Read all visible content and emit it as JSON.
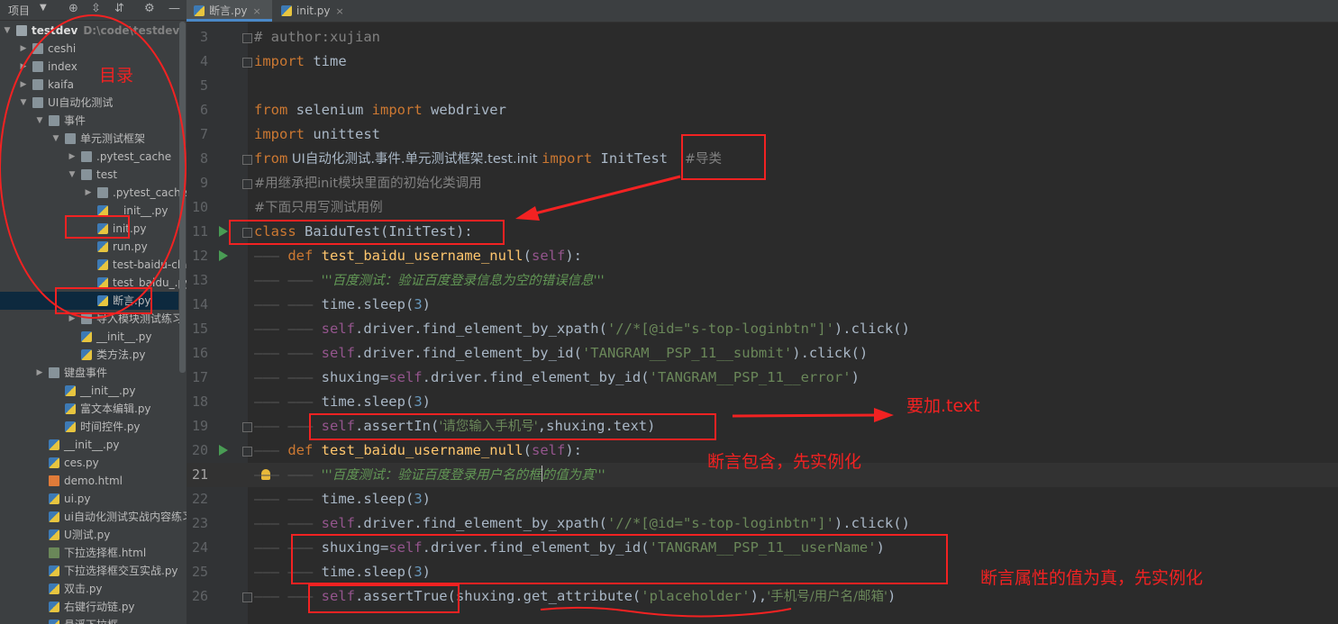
{
  "project_panel": {
    "title": "项目",
    "tree": [
      {
        "name": "testdev",
        "path": "D:\\code\\testdev",
        "kind": "folder",
        "depth": 0,
        "expanded": true,
        "root": true
      },
      {
        "name": "ceshi",
        "kind": "folder",
        "depth": 1,
        "expanded": false
      },
      {
        "name": "index",
        "kind": "folder",
        "depth": 1,
        "expanded": false
      },
      {
        "name": "kaifa",
        "kind": "folder",
        "depth": 1,
        "expanded": false
      },
      {
        "name": "UI自动化测试",
        "kind": "folder",
        "depth": 1,
        "expanded": true
      },
      {
        "name": "事件",
        "kind": "folder",
        "depth": 2,
        "expanded": true
      },
      {
        "name": "单元测试框架",
        "kind": "folder",
        "depth": 3,
        "expanded": true
      },
      {
        "name": ".pytest_cache",
        "kind": "folder",
        "depth": 4,
        "expanded": false
      },
      {
        "name": "test",
        "kind": "folder",
        "depth": 4,
        "expanded": true
      },
      {
        "name": ".pytest_cache",
        "kind": "folder",
        "depth": 5,
        "expanded": false
      },
      {
        "name": "__init__.py",
        "kind": "py",
        "depth": 5
      },
      {
        "name": "init.py",
        "kind": "py",
        "depth": 5
      },
      {
        "name": "run.py",
        "kind": "py",
        "depth": 5
      },
      {
        "name": "test-baidu-class.p",
        "kind": "py",
        "depth": 5
      },
      {
        "name": "test_baidu_.py",
        "kind": "py",
        "depth": 5
      },
      {
        "name": "断言.py",
        "kind": "py",
        "depth": 5,
        "selected": true
      },
      {
        "name": "导入模块测试练习",
        "kind": "folder",
        "depth": 4,
        "expanded": false
      },
      {
        "name": "__init__.py",
        "kind": "py",
        "depth": 4
      },
      {
        "name": "类方法.py",
        "kind": "py",
        "depth": 4
      },
      {
        "name": "键盘事件",
        "kind": "folder",
        "depth": 2,
        "expanded": false
      },
      {
        "name": "__init__.py",
        "kind": "py",
        "depth": 3
      },
      {
        "name": "富文本编辑.py",
        "kind": "py",
        "depth": 3
      },
      {
        "name": "时间控件.py",
        "kind": "py",
        "depth": 3
      },
      {
        "name": "__init__.py",
        "kind": "py",
        "depth": 2
      },
      {
        "name": "ces.py",
        "kind": "py",
        "depth": 2
      },
      {
        "name": "demo.html",
        "kind": "html",
        "depth": 2
      },
      {
        "name": "ui.py",
        "kind": "py",
        "depth": 2
      },
      {
        "name": "ui自动化测试实战内容练习.p",
        "kind": "py",
        "depth": 2
      },
      {
        "name": "U测试.py",
        "kind": "py",
        "depth": 2
      },
      {
        "name": "下拉选择框.html",
        "kind": "pyc",
        "depth": 2
      },
      {
        "name": "下拉选择框交互实战.py",
        "kind": "py",
        "depth": 2
      },
      {
        "name": "双击.py",
        "kind": "py",
        "depth": 2
      },
      {
        "name": "右键行动链.py",
        "kind": "py",
        "depth": 2
      },
      {
        "name": "悬浮下拉框",
        "kind": "py",
        "depth": 2
      }
    ]
  },
  "tabs": [
    {
      "label": "断言.py",
      "active": true
    },
    {
      "label": "init.py",
      "active": false
    }
  ],
  "editor": {
    "current_line": 21,
    "lines": [
      {
        "n": 3,
        "tokens": [
          [
            "cm",
            "# author:xujian"
          ]
        ]
      },
      {
        "n": 4,
        "tokens": [
          [
            "kw",
            "import"
          ],
          [
            "",
            " time"
          ]
        ]
      },
      {
        "n": 5,
        "tokens": []
      },
      {
        "n": 6,
        "tokens": [
          [
            "kw",
            "from"
          ],
          [
            "",
            " selenium "
          ],
          [
            "kw",
            "import"
          ],
          [
            "",
            " webdriver"
          ]
        ]
      },
      {
        "n": 7,
        "tokens": [
          [
            "kw",
            "import"
          ],
          [
            "",
            " unittest"
          ]
        ]
      },
      {
        "n": 8,
        "tokens": [
          [
            "kw",
            "from"
          ],
          [
            "",
            " UI自动化测试.事件.单元测试框架.test.init "
          ],
          [
            "kw",
            "import"
          ],
          [
            "",
            " InitTest  "
          ],
          [
            "cm",
            "#导类"
          ]
        ]
      },
      {
        "n": 9,
        "tokens": [
          [
            "cm",
            "#用继承把init模块里面的初始化类调用"
          ]
        ]
      },
      {
        "n": 10,
        "tokens": [
          [
            "cm",
            "#下面只用写测试用例"
          ]
        ]
      },
      {
        "n": 11,
        "run": true,
        "tokens": [
          [
            "kw",
            "class"
          ],
          [
            "",
            " BaiduTest(InitTest):"
          ]
        ]
      },
      {
        "n": 12,
        "run": true,
        "indent": 1,
        "tokens": [
          [
            "kw",
            "def"
          ],
          [
            "",
            " "
          ],
          [
            "fn",
            "test_baidu_username_null"
          ],
          [
            "",
            "("
          ],
          [
            "self",
            "self"
          ],
          [
            "",
            "):"
          ]
        ]
      },
      {
        "n": 13,
        "indent": 2,
        "tokens": [
          [
            "doc",
            "'''百度测试：验证百度登录信息为空的错误信息'''"
          ]
        ]
      },
      {
        "n": 14,
        "indent": 2,
        "tokens": [
          [
            "",
            "time.sleep("
          ],
          [
            "num",
            "3"
          ],
          [
            "",
            ")"
          ]
        ]
      },
      {
        "n": 15,
        "indent": 2,
        "tokens": [
          [
            "self",
            "self"
          ],
          [
            "",
            ".driver.find_element_by_xpath("
          ],
          [
            "str",
            "'//*[@id=\"s-top-loginbtn\"]'"
          ],
          [
            "",
            ").click()"
          ]
        ]
      },
      {
        "n": 16,
        "indent": 2,
        "tokens": [
          [
            "self",
            "self"
          ],
          [
            "",
            ".driver.find_element_by_id("
          ],
          [
            "str",
            "'TANGRAM__PSP_11__submit'"
          ],
          [
            "",
            ").click()"
          ]
        ]
      },
      {
        "n": 17,
        "indent": 2,
        "tokens": [
          [
            "",
            "shuxing="
          ],
          [
            "self",
            "self"
          ],
          [
            "",
            ".driver.find_element_by_id("
          ],
          [
            "str",
            "'TANGRAM__PSP_11__error'"
          ],
          [
            "",
            ")"
          ]
        ]
      },
      {
        "n": 18,
        "indent": 2,
        "tokens": [
          [
            "",
            "time.sleep("
          ],
          [
            "num",
            "3"
          ],
          [
            "",
            ")"
          ]
        ]
      },
      {
        "n": 19,
        "indent": 2,
        "tokens": [
          [
            "self",
            "self"
          ],
          [
            "",
            ".assertIn("
          ],
          [
            "str",
            "'请您输入手机号'"
          ],
          [
            "",
            ",shuxing.text)"
          ]
        ]
      },
      {
        "n": 20,
        "run": true,
        "indent": 1,
        "tokens": [
          [
            "kw",
            "def"
          ],
          [
            "",
            " "
          ],
          [
            "fn",
            "test_baidu_username_null"
          ],
          [
            "",
            "("
          ],
          [
            "self",
            "self"
          ],
          [
            "",
            "):"
          ]
        ]
      },
      {
        "n": 21,
        "indent": 2,
        "bulb": true,
        "tokens": [
          [
            "doc",
            "'''百度测试：验证百度登录用户名的框"
          ],
          [
            "caret",
            ""
          ],
          [
            "doc",
            "的值为真'''"
          ]
        ]
      },
      {
        "n": 22,
        "indent": 2,
        "tokens": [
          [
            "",
            "time.sleep("
          ],
          [
            "num",
            "3"
          ],
          [
            "",
            ")"
          ]
        ]
      },
      {
        "n": 23,
        "indent": 2,
        "tokens": [
          [
            "self",
            "self"
          ],
          [
            "",
            ".driver.find_element_by_xpath("
          ],
          [
            "str",
            "'//*[@id=\"s-top-loginbtn\"]'"
          ],
          [
            "",
            ").click()"
          ]
        ]
      },
      {
        "n": 24,
        "indent": 2,
        "tokens": [
          [
            "",
            "shuxing="
          ],
          [
            "self",
            "self"
          ],
          [
            "",
            ".driver.find_element_by_id("
          ],
          [
            "str",
            "'TANGRAM__PSP_11__userName'"
          ],
          [
            "",
            ")"
          ]
        ]
      },
      {
        "n": 25,
        "indent": 2,
        "tokens": [
          [
            "",
            "time.sleep("
          ],
          [
            "num",
            "3"
          ],
          [
            "",
            ")"
          ]
        ]
      },
      {
        "n": 26,
        "indent": 2,
        "tokens": [
          [
            "self",
            "self"
          ],
          [
            "",
            ".assertTrue(shuxing.get_attribute("
          ],
          [
            "str",
            "'placeholder'"
          ],
          [
            "",
            "),"
          ],
          [
            "str",
            "'手机号/用户名/邮箱'"
          ],
          [
            "",
            ")"
          ]
        ]
      }
    ]
  },
  "annotations": {
    "directory": "目录",
    "add_text": "要加.text",
    "assert_contains": "断言包含，先实例化",
    "assert_attr_true": "断言属性的值为真，先实例化",
    "color": "#f22222"
  }
}
